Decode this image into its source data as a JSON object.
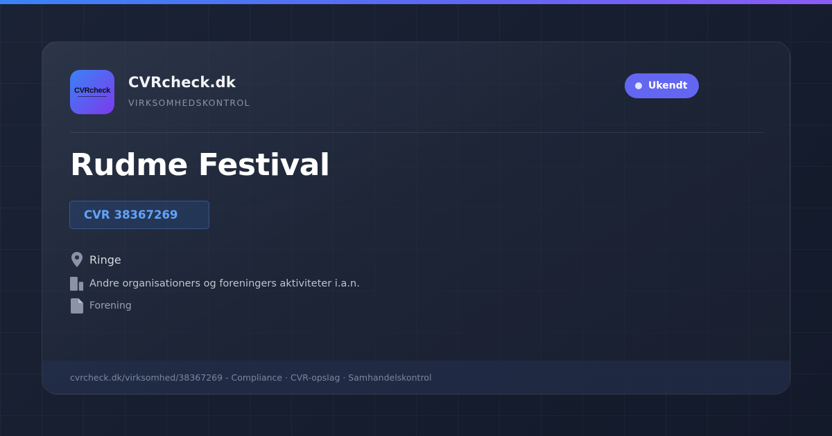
{
  "colors": {
    "accent_gradient": [
      "#3b82f6",
      "#8b5cf6"
    ],
    "status_badge": "#6366f1",
    "cvr": "#60a5fa",
    "background": "#141b2c"
  },
  "brand": {
    "logo_text": "CVRcheck",
    "name": "CVRcheck.dk",
    "tagline": "VIRKSOMHEDSKONTROL"
  },
  "status": {
    "label": "Ukendt"
  },
  "company": {
    "name": "Rudme Festival",
    "cvr_prefix": "CVR",
    "cvr_number": "38367269",
    "location": "Ringe",
    "industry": "Andre organisationers og foreningers aktiviteter i.a.n.",
    "type": "Forening"
  },
  "icons": {
    "location": "map-pin-icon",
    "industry": "building-icon",
    "type": "document-icon"
  },
  "footer": {
    "text": "cvrcheck.dk/virksomhed/38367269 - Compliance · CVR-opslag · Samhandelskontrol"
  }
}
